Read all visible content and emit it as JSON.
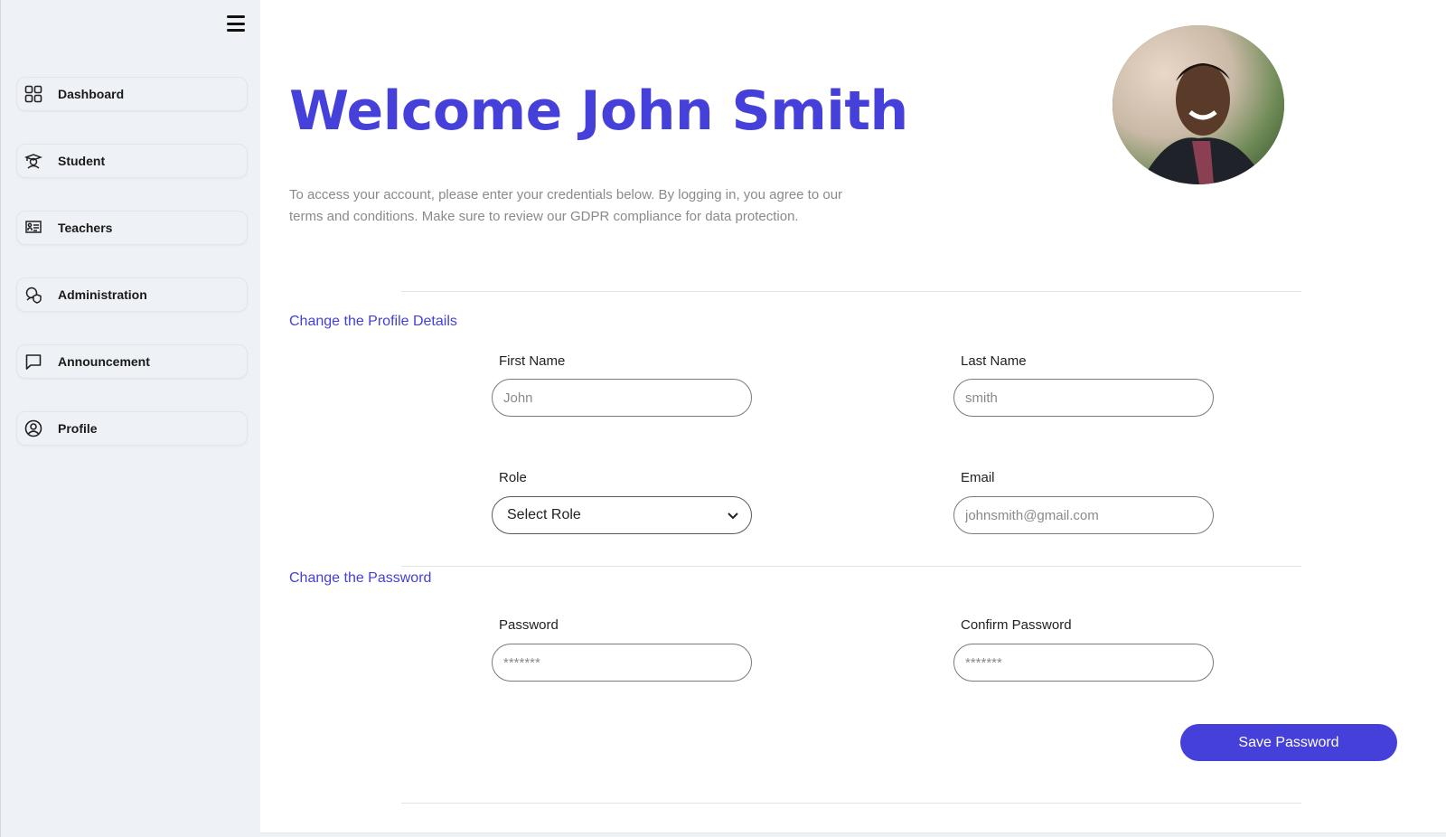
{
  "sidebar": {
    "items": [
      {
        "label": "Dashboard",
        "icon": "grid-icon"
      },
      {
        "label": "Student",
        "icon": "student-icon"
      },
      {
        "label": "Teachers",
        "icon": "teacher-board-icon"
      },
      {
        "label": "Administration",
        "icon": "admin-shield-icon"
      },
      {
        "label": "Announcement",
        "icon": "chat-bubble-icon"
      },
      {
        "label": "Profile",
        "icon": "user-circle-icon"
      }
    ]
  },
  "header": {
    "title": "Welcome John Smith",
    "intro": "To access your account, please enter your credentials below. By logging in, you agree to our terms and conditions. Make sure to review our GDPR compliance for data protection."
  },
  "profile_section": {
    "title": "Change the Profile Details",
    "first_name": {
      "label": "First Name",
      "placeholder": "John"
    },
    "last_name": {
      "label": "Last Name",
      "placeholder": "smith"
    },
    "role": {
      "label": "Role",
      "selected": "Select Role"
    },
    "email": {
      "label": "Email",
      "placeholder": "johnsmith@gmail.com"
    }
  },
  "password_section": {
    "title": "Change the Password",
    "password": {
      "label": "Password",
      "placeholder": "*******"
    },
    "confirm": {
      "label": "Confirm Password",
      "placeholder": "*******"
    },
    "save_label": "Save Password"
  },
  "colors": {
    "accent": "#4440d9",
    "sidebar_bg": "#eef1f6"
  }
}
